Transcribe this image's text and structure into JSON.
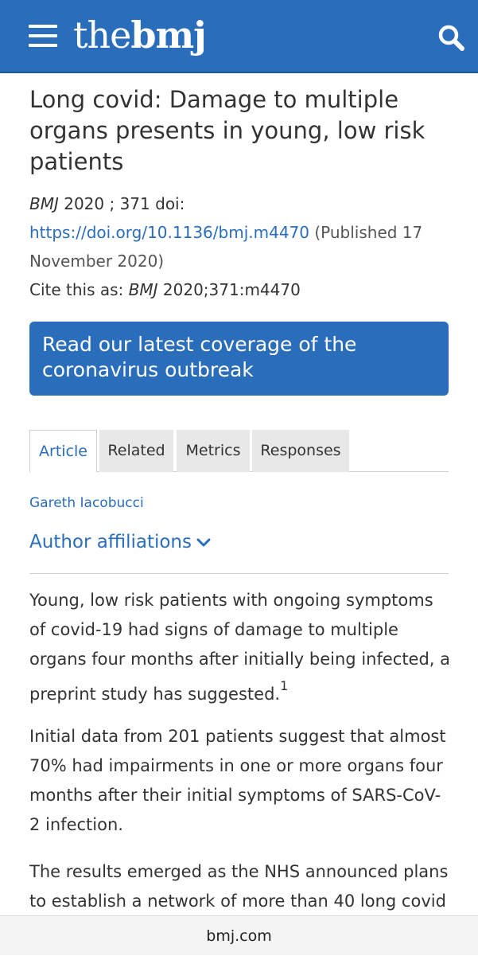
{
  "header": {
    "logo_the": "the",
    "logo_bmj": "bmj",
    "menu_icon": "hamburger-menu-icon",
    "search_icon": "search-icon",
    "brand_color": "#2a6ebb"
  },
  "article": {
    "title": "Long covid: Damage to multiple organs presents in young, low risk patients",
    "journal": "BMJ",
    "year_volume": " 2020 ; 371 ",
    "doi_label": " doi:",
    "doi_url": "https://doi.org/10.1136/bmj.m4470",
    "published": " (Published 17 November 2020)",
    "cite_label": "Cite this as: ",
    "cite_journal": "BMJ",
    "cite_ref": " 2020;371:m4470"
  },
  "coverage_button": {
    "label": "Read our latest coverage of the coronavirus outbreak"
  },
  "tabs": [
    {
      "label": "Article",
      "active": true
    },
    {
      "label": "Related",
      "active": false
    },
    {
      "label": "Metrics",
      "active": false
    },
    {
      "label": "Responses",
      "active": false
    }
  ],
  "author": "Gareth Iacobucci",
  "affiliations_label": "Author affiliations",
  "paragraphs": [
    {
      "text": "Young, low risk patients with ongoing symptoms of covid-19 had signs of damage to multiple organs four months after initially being infected, a preprint study has suggested.",
      "footnote": "1"
    },
    {
      "text": "Initial data from 201 patients suggest that almost 70% had impairments in one or more organs four months after their initial symptoms of SARS-CoV-2 infection."
    },
    {
      "text": "The results emerged as the NHS announced plans to establish a network of more than 40 long covid"
    }
  ],
  "url_bar": {
    "domain": "bmj.com"
  }
}
